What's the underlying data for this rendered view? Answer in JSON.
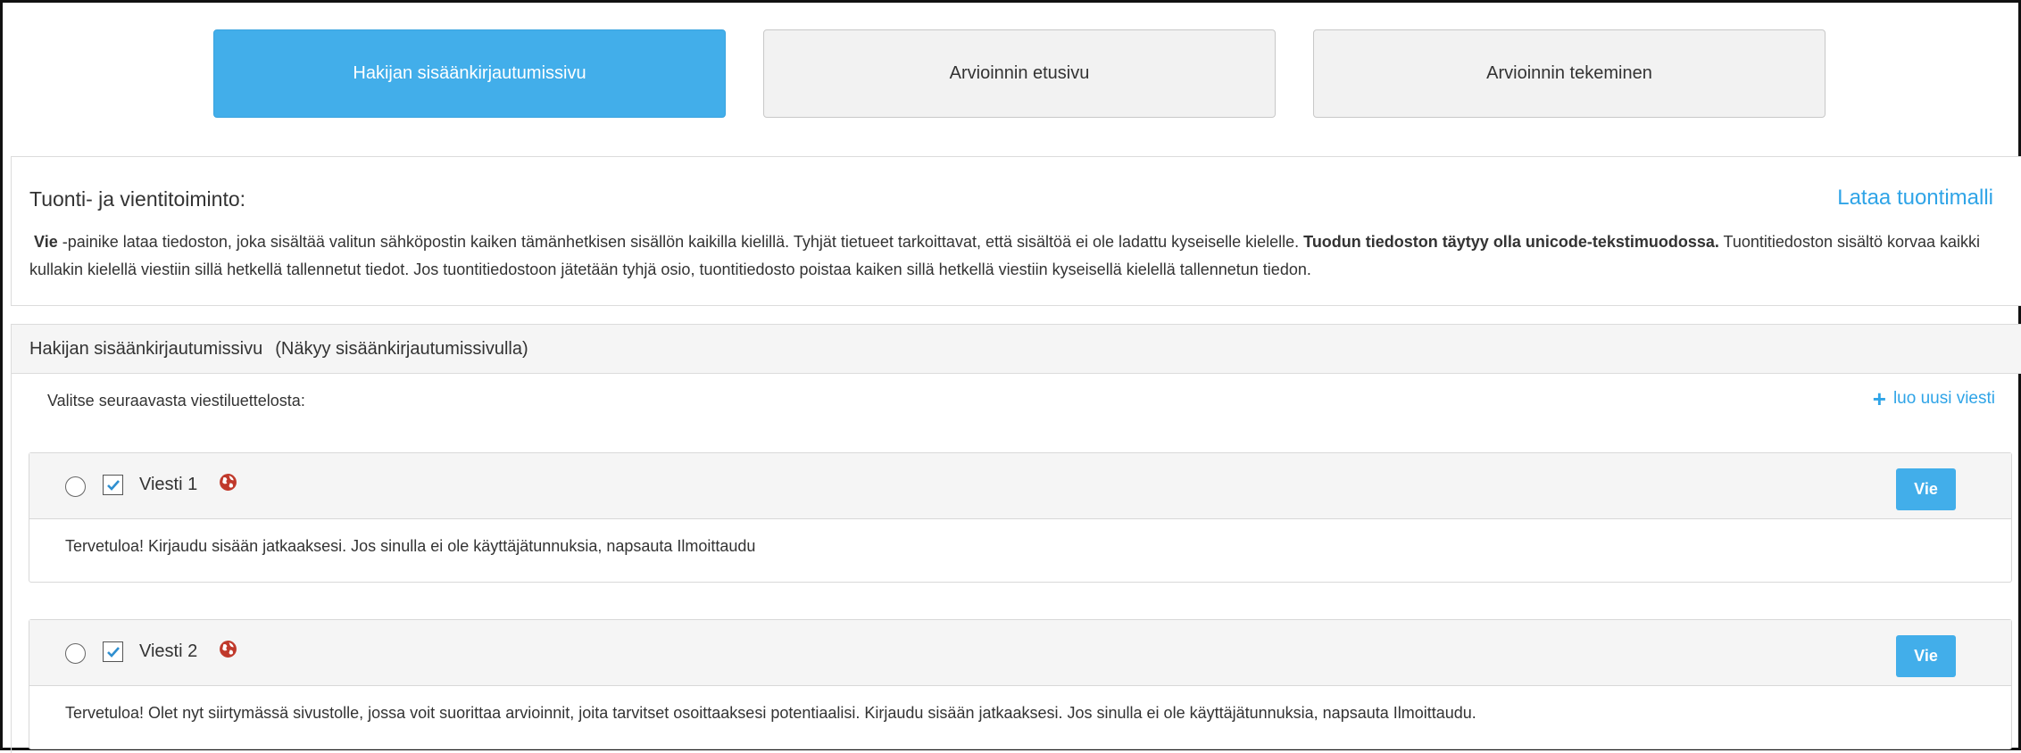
{
  "tabs": [
    {
      "label": "Hakijan sisäänkirjautumissivu",
      "active": true
    },
    {
      "label": "Arvioinnin etusivu",
      "active": false
    },
    {
      "label": "Arvioinnin tekeminen",
      "active": false
    }
  ],
  "import_export": {
    "title": "Tuonti- ja vientitoiminto:",
    "download_template_link": "Lataa tuontimalli",
    "text_lead_bold": "Vie",
    "text_part1": " -painike lataa tiedoston, joka sisältää valitun sähköpostin kaiken tämänhetkisen sisällön kaikilla kielillä. Tyhjät tietueet tarkoittavat, että sisältöä ei ole ladattu kyseiselle kielelle. ",
    "text_bold2": "Tuodun tiedoston täytyy olla unicode-tekstimuodossa.",
    "text_part2": " Tuontitiedoston sisältö korvaa kaikki kullakin kielellä viestiin sillä hetkellä tallennetut tiedot. Jos tuontitiedostoon jätetään tyhjä osio, tuontitiedosto poistaa kaiken sillä hetkellä viestiin kyseisellä kielellä tallennetun tiedon."
  },
  "section": {
    "title": "Hakijan sisäänkirjautumissivu",
    "note": "(Näkyy sisäänkirjautumissivulla)",
    "select_label": "Valitse seuraavasta viestiluettelosta:",
    "new_message_label": "luo uusi viesti",
    "new_message_icon": "plus-icon"
  },
  "messages": [
    {
      "name": "Viesti 1",
      "checked": true,
      "icon": "globe-icon",
      "export_label": "Vie",
      "body": "Tervetuloa! Kirjaudu sisään jatkaaksesi. Jos sinulla ei ole käyttäjätunnuksia, napsauta Ilmoittaudu"
    },
    {
      "name": "Viesti 2",
      "checked": true,
      "icon": "globe-icon",
      "export_label": "Vie",
      "body": "Tervetuloa! Olet nyt siirtymässä sivustolle, jossa voit suorittaa arvioinnit, joita tarvitset osoittaaksesi potentiaalisi. Kirjaudu sisään jatkaaksesi. Jos sinulla ei ole käyttäjätunnuksia, napsauta Ilmoittaudu."
    }
  ],
  "colors": {
    "accent": "#42aeea",
    "link": "#2fa4e7",
    "globe": "#c0392b",
    "panel_header": "#f5f5f5"
  }
}
